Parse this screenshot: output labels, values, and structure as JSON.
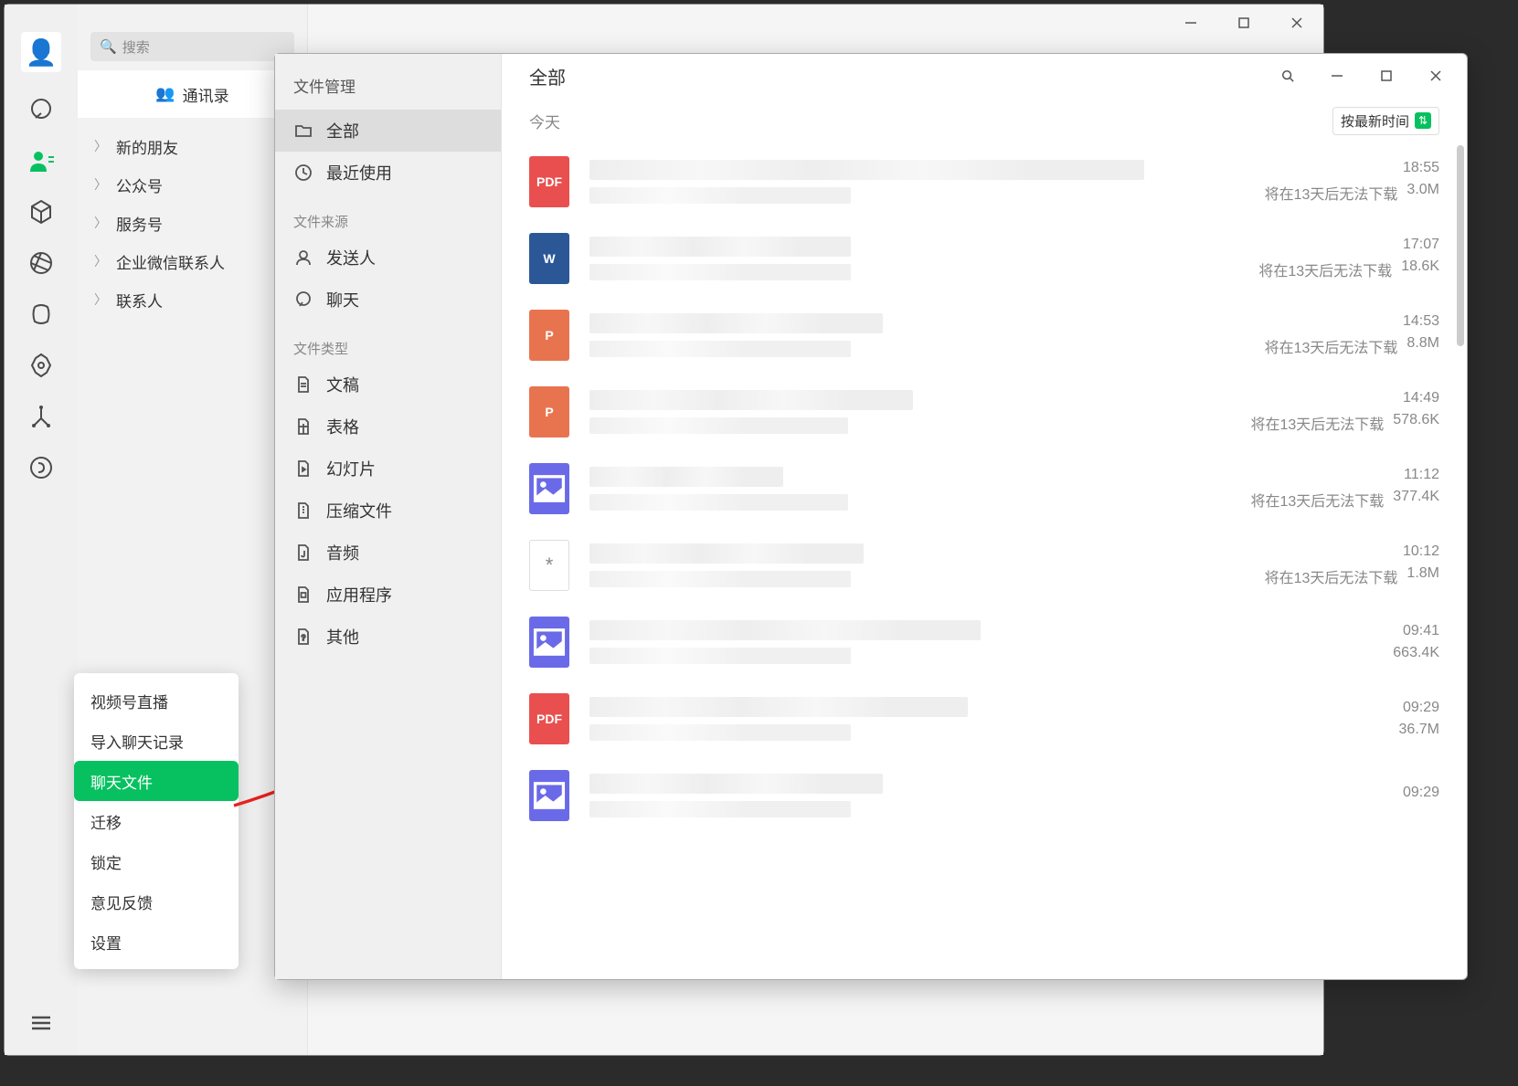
{
  "main_window": {
    "search_placeholder": "搜索",
    "contacts_mgmt": "通讯录",
    "collapse_items": [
      "新的朋友",
      "公众号",
      "服务号",
      "企业微信联系人",
      "联系人"
    ]
  },
  "popup_menu": {
    "items": [
      {
        "label": "视频号直播",
        "highlight": false
      },
      {
        "label": "导入聊天记录",
        "highlight": false
      },
      {
        "label": "聊天文件",
        "highlight": true
      },
      {
        "label": "迁移",
        "highlight": false
      },
      {
        "label": "锁定",
        "highlight": false
      },
      {
        "label": "意见反馈",
        "highlight": false
      },
      {
        "label": "设置",
        "highlight": false
      }
    ]
  },
  "filemgr": {
    "sidebar": {
      "title": "文件管理",
      "all": "全部",
      "recent": "最近使用",
      "source_section": "文件来源",
      "sender": "发送人",
      "chat": "聊天",
      "type_section": "文件类型",
      "doc": "文稿",
      "sheet": "表格",
      "slide": "幻灯片",
      "archive": "压缩文件",
      "audio": "音频",
      "app": "应用程序",
      "other": "其他"
    },
    "header_title": "全部",
    "today_label": "今天",
    "sort_label": "按最新时间",
    "expire_text": "将在13天后无法下载",
    "files": [
      {
        "type": "pdf",
        "icon_text": "PDF",
        "suffix": "pdf",
        "time": "18:55",
        "size": "3.0M",
        "expire": true,
        "name_width": "85%"
      },
      {
        "type": "doc",
        "icon_text": "W",
        "suffix": "",
        "time": "17:07",
        "size": "18.6K",
        "expire": true,
        "name_width": "40%"
      },
      {
        "type": "ppt",
        "icon_text": "P",
        "suffix": "",
        "time": "14:53",
        "size": "8.8M",
        "expire": true,
        "name_width": "45%"
      },
      {
        "type": "ppt",
        "icon_text": "P",
        "suffix": "",
        "time": "14:49",
        "size": "578.6K",
        "expire": true,
        "name_width": "50%"
      },
      {
        "type": "img",
        "icon_text": "",
        "suffix": "",
        "time": "11:12",
        "size": "377.4K",
        "expire": true,
        "name_width": "30%"
      },
      {
        "type": "unk",
        "icon_text": "*",
        "suffix": "",
        "time": "10:12",
        "size": "1.8M",
        "expire": true,
        "name_width": "42%"
      },
      {
        "type": "img",
        "icon_text": "",
        "suffix": "",
        "time": "09:41",
        "size": "663.4K",
        "expire": false,
        "name_width": "60%"
      },
      {
        "type": "pdf",
        "icon_text": "PDF",
        "suffix": "",
        "time": "09:29",
        "size": "36.7M",
        "expire": false,
        "name_width": "58%"
      },
      {
        "type": "img",
        "icon_text": "",
        "suffix": "",
        "time": "09:29",
        "size": "",
        "expire": false,
        "name_width": "45%"
      }
    ]
  }
}
